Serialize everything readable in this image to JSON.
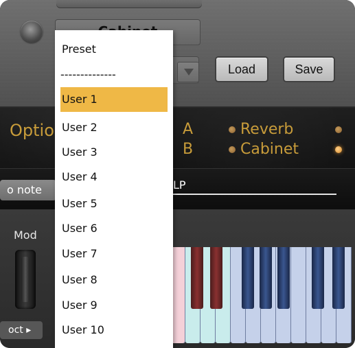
{
  "header": {
    "cabinet_button_label": "Cabinet",
    "load_label": "Load",
    "save_label": "Save"
  },
  "options": {
    "options_label": "Options",
    "a_label": "A",
    "b_label": "B",
    "reverb_label": "Reverb",
    "cabinet_label": "Cabinet"
  },
  "strip": {
    "no_note_label": "o note",
    "lp_label": "LP"
  },
  "keyboard": {
    "mod_label": "Mod",
    "oct_label": "oct ▸"
  },
  "menu": {
    "items": [
      "Preset",
      "--------------",
      "User 1",
      "User 2",
      "User 3",
      "User 4",
      "User 5",
      "User 6",
      "User 7",
      "User 8",
      "User 9",
      "User 10"
    ],
    "selected_index": 2,
    "highlight_color": "#efb846"
  },
  "colors": {
    "amber_text": "#c89c3a",
    "led_bright": "#e09a33"
  }
}
